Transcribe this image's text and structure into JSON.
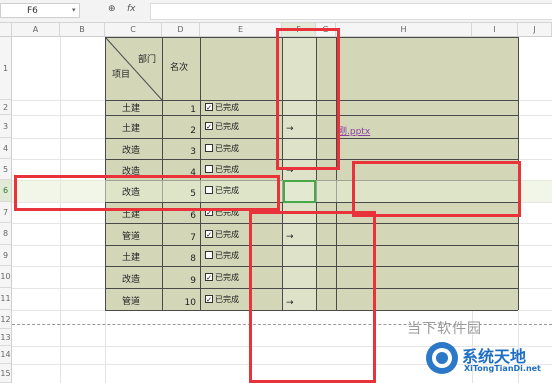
{
  "namebox": "F6",
  "formula_icons": {
    "zoom": "magnify-icon",
    "fx": "fx"
  },
  "columns": [
    "A",
    "B",
    "C",
    "D",
    "E",
    "F",
    "G",
    "H",
    "I",
    "J"
  ],
  "rows": [
    "1",
    "2",
    "3",
    "4",
    "5",
    "6",
    "7",
    "8",
    "9",
    "10",
    "11",
    "12",
    "13",
    "14",
    "15"
  ],
  "table": {
    "header_top": "部门",
    "header_bottom": "项目",
    "header_rank": "名次",
    "rows": [
      {
        "dept": "土建",
        "rank": "1",
        "checked": true,
        "label": "已完成"
      },
      {
        "dept": "土建",
        "rank": "2",
        "checked": true,
        "label": "已完成"
      },
      {
        "dept": "改造",
        "rank": "3",
        "checked": false,
        "label": "已完成"
      },
      {
        "dept": "改造",
        "rank": "4",
        "checked": false,
        "label": "已完成"
      },
      {
        "dept": "改造",
        "rank": "5",
        "checked": false,
        "label": "已完成"
      },
      {
        "dept": "土建",
        "rank": "6",
        "checked": true,
        "label": "已完成"
      },
      {
        "dept": "管道",
        "rank": "7",
        "checked": true,
        "label": "已完成"
      },
      {
        "dept": "土建",
        "rank": "8",
        "checked": false,
        "label": "已完成"
      },
      {
        "dept": "改造",
        "rank": "9",
        "checked": true,
        "label": "已完成"
      },
      {
        "dept": "管道",
        "rank": "10",
        "checked": true,
        "label": "已完成"
      }
    ],
    "link_text": "刚.pptx",
    "arrow": "→"
  },
  "watermark": {
    "line1": "当下软件园",
    "brand": "系统天地",
    "url": "XiTongTianDi.net"
  },
  "colors": {
    "table_bg": "#d3d7b8",
    "highlight": "#e8333a",
    "selection": "#48a74a",
    "link": "#8a3ea0"
  }
}
